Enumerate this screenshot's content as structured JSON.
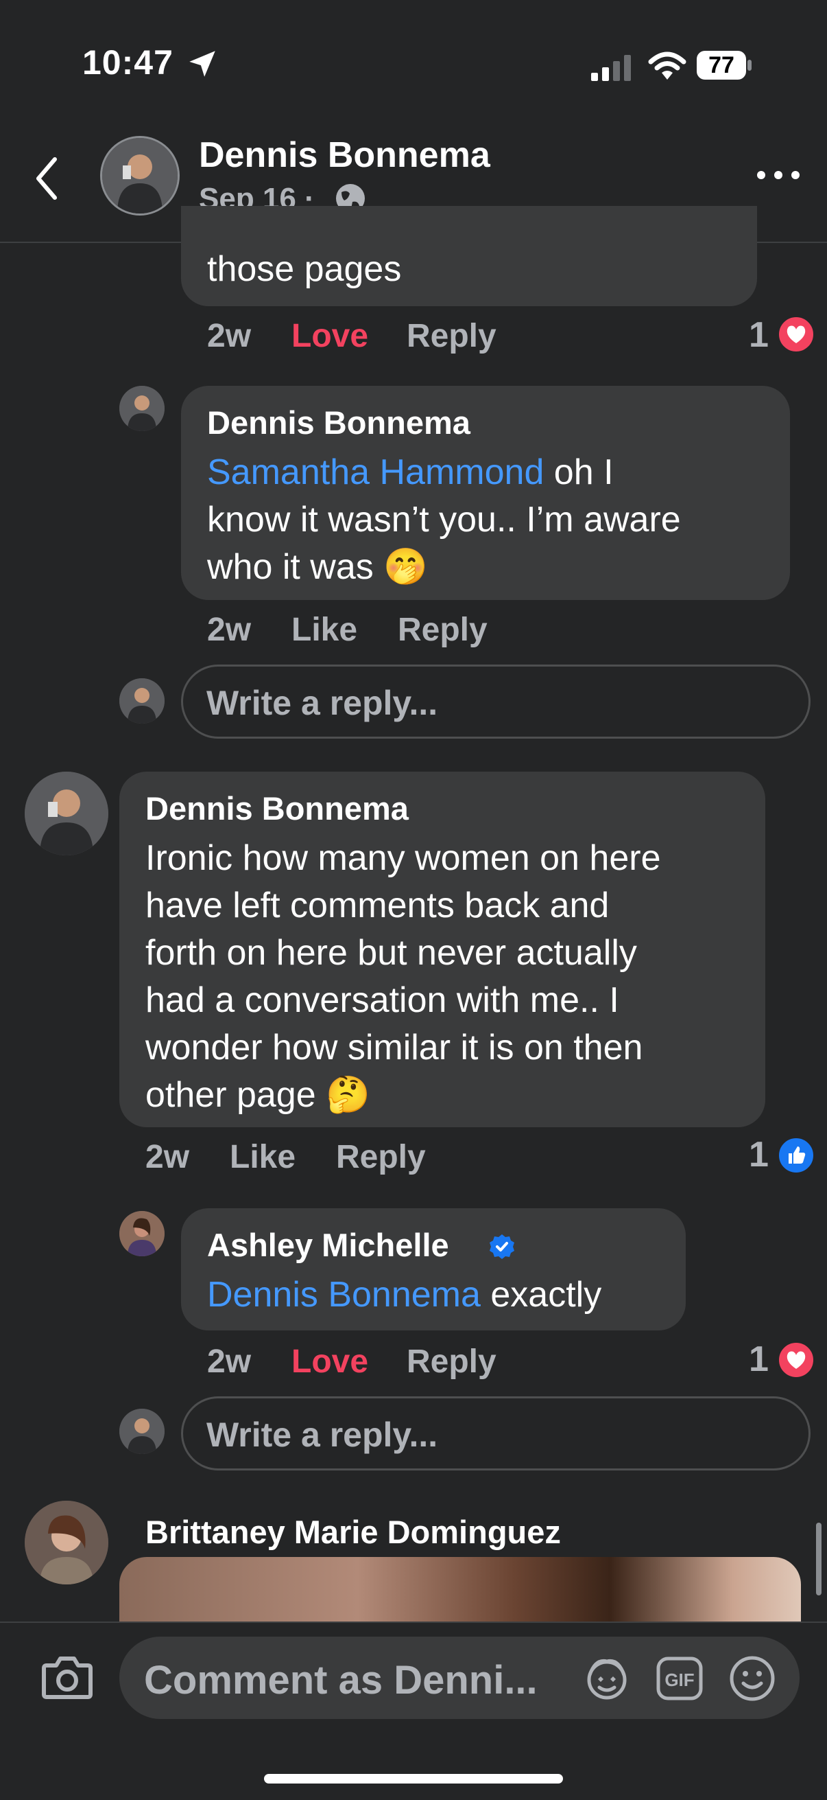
{
  "status_bar": {
    "time": "10:47",
    "battery": "77"
  },
  "header": {
    "name": "Dennis Bonnema",
    "date": "Sep 16 ·"
  },
  "comments": [
    {
      "text": "those pages",
      "time": "2w",
      "reaction_label": "Love",
      "reply_label": "Reply",
      "reaction_count": "1"
    },
    {
      "name": "Dennis Bonnema",
      "mention": "Samantha Hammond",
      "text_line1": " oh I",
      "text_line2": "know it wasn’t you.. I’m aware",
      "text_line3": "who it was 🤭",
      "time": "2w",
      "reaction_label": "Like",
      "reply_label": "Reply"
    },
    {
      "name": "Dennis Bonnema",
      "lines": [
        "Ironic how many women on here",
        "have left comments back and",
        "forth on here but never actually",
        "had a conversation with me..  I",
        "wonder how similar it is on then",
        "other page 🤔"
      ],
      "time": "2w",
      "reaction_label": "Like",
      "reply_label": "Reply",
      "reaction_count": "1"
    },
    {
      "name": "Ashley Michelle",
      "mention": "Dennis Bonnema",
      "text": " exactly",
      "time": "2w",
      "reaction_label": "Love",
      "reply_label": "Reply",
      "reaction_count": "1"
    },
    {
      "name": "Brittaney Marie Dominguez"
    }
  ],
  "reply_placeholder": "Write a reply...",
  "comment_placeholder": "Comment as Denni...",
  "colors": {
    "background": "#242526",
    "bubble": "#3a3b3c",
    "mention": "#4599ff",
    "love": "#f3425f",
    "like": "#1877f2"
  },
  "icons": [
    "location-arrow-icon",
    "signal-icon",
    "wifi-icon",
    "battery-icon",
    "back-icon",
    "globe-icon",
    "more-icon",
    "heart-icon",
    "like-icon",
    "verified-icon",
    "camera-icon",
    "avatar-sticker-icon",
    "gif-icon",
    "emoji-icon"
  ]
}
